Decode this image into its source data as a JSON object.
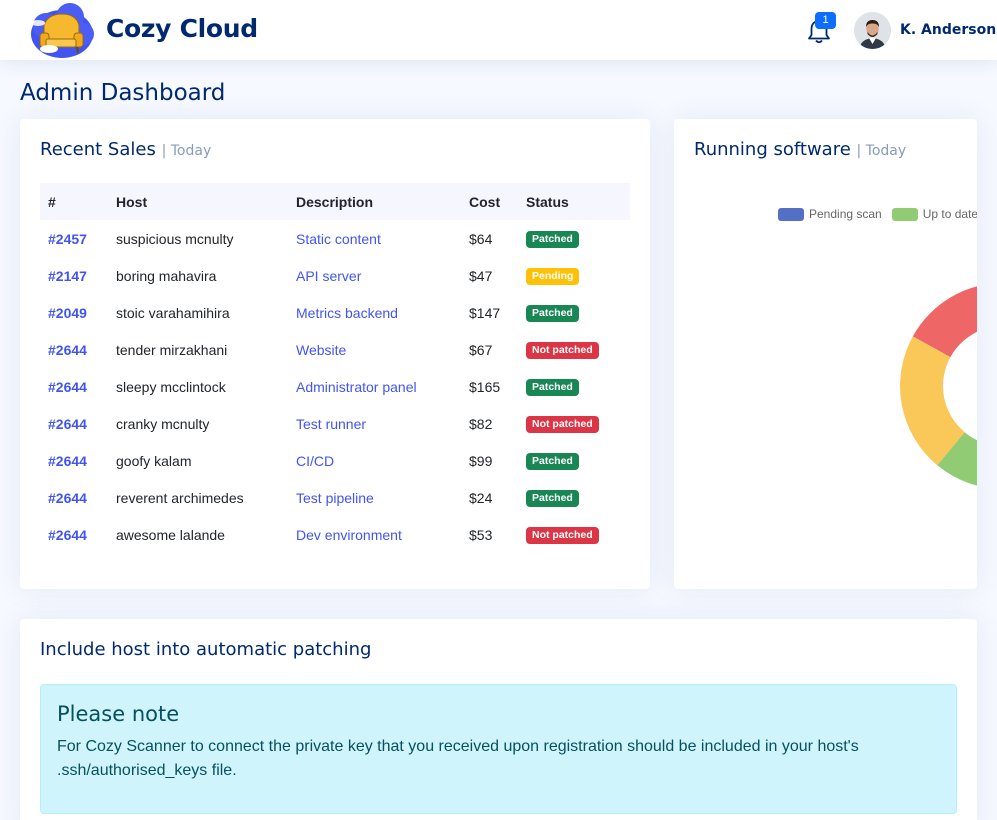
{
  "header": {
    "brand": "Cozy Cloud",
    "notification_count": "1",
    "username": "K. Anderson"
  },
  "page_title": "Admin Dashboard",
  "recent_sales": {
    "title": "Recent Sales",
    "subtitle": "| Today",
    "columns": [
      "#",
      "Host",
      "Description",
      "Cost",
      "Status"
    ],
    "rows": [
      {
        "id": "#2457",
        "host": "suspicious mcnulty",
        "description": "Static content",
        "cost": "$64",
        "status": "Patched"
      },
      {
        "id": "#2147",
        "host": "boring mahavira",
        "description": "API server",
        "cost": "$47",
        "status": "Pending"
      },
      {
        "id": "#2049",
        "host": "stoic varahamihira",
        "description": "Metrics backend",
        "cost": "$147",
        "status": "Patched"
      },
      {
        "id": "#2644",
        "host": "tender mirzakhani",
        "description": "Website",
        "cost": "$67",
        "status": "Not patched"
      },
      {
        "id": "#2644",
        "host": "sleepy mcclintock",
        "description": "Administrator panel",
        "cost": "$165",
        "status": "Patched"
      },
      {
        "id": "#2644",
        "host": "cranky mcnulty",
        "description": "Test runner",
        "cost": "$82",
        "status": "Not patched"
      },
      {
        "id": "#2644",
        "host": "goofy kalam",
        "description": "CI/CD",
        "cost": "$99",
        "status": "Patched"
      },
      {
        "id": "#2644",
        "host": "reverent archimedes",
        "description": "Test pipeline",
        "cost": "$24",
        "status": "Patched"
      },
      {
        "id": "#2644",
        "host": "awesome lalande",
        "description": "Dev environment",
        "cost": "$53",
        "status": "Not patched"
      }
    ],
    "status_colors": {
      "Patched": "#198754",
      "Pending": "#ffc107",
      "Not patched": "#dc3545"
    }
  },
  "running_software": {
    "title": "Running software",
    "subtitle": "| Today",
    "legend": [
      {
        "label": "Pending scan",
        "color": "#5470c6"
      },
      {
        "label": "Up to date",
        "color": "#91cc75"
      }
    ]
  },
  "patching": {
    "title": "Include host into automatic patching",
    "alert_heading": "Please note",
    "alert_text": "For Cozy Scanner to connect the private key that you received upon registration should be included in your host's .ssh/authorised_keys file."
  }
}
